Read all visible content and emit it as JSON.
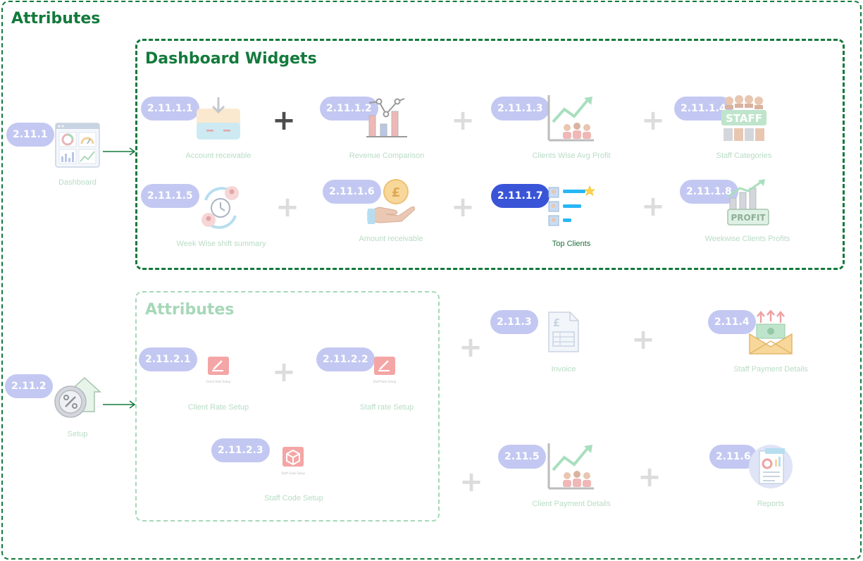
{
  "frames": {
    "outer_title": "Attributes",
    "dashboard_title": "Dashboard Widgets",
    "attributes_title": "Attributes"
  },
  "roots": [
    {
      "code": "2.11.1",
      "label": "Dashboard"
    },
    {
      "code": "2.11.2",
      "label": "Setup"
    }
  ],
  "widgets": [
    {
      "code": "2.11.1.1",
      "label": "Account receivable"
    },
    {
      "code": "2.11.1.2",
      "label": "Revenue Comparison"
    },
    {
      "code": "2.11.1.3",
      "label": "Clients Wise Avg Profit"
    },
    {
      "code": "2.11.1.4",
      "label": "Staff Categories",
      "icon_text": "STAFF"
    },
    {
      "code": "2.11.1.5",
      "label": "Week Wise shift summary"
    },
    {
      "code": "2.11.1.6",
      "label": "Amount receivable",
      "icon_text": "£"
    },
    {
      "code": "2.11.1.7",
      "label": "Top Clients",
      "active": true
    },
    {
      "code": "2.11.1.8",
      "label": "Weekwise Clients Profits",
      "icon_text": "PROFIT"
    }
  ],
  "setup_attributes": [
    {
      "code": "2.11.2.1",
      "label": "Client Rate Setup",
      "icon_caption": "Client Rate Setup"
    },
    {
      "code": "2.11.2.2",
      "label": "Staff rate Setup",
      "icon_caption": "Staff Rate Setup"
    },
    {
      "code": "2.11.2.3",
      "label": "Staff Code Setup",
      "icon_caption": "Staff Code Setup"
    }
  ],
  "setup_items": [
    {
      "code": "2.11.3",
      "label": "Invoice",
      "icon_text": "£"
    },
    {
      "code": "2.11.4",
      "label": "Staff Payment Details"
    },
    {
      "code": "2.11.5",
      "label": "Client Payment Details"
    },
    {
      "code": "2.11.6",
      "label": "Reports"
    }
  ],
  "plus_symbol": "+",
  "colors": {
    "frame_green": "#137a3c",
    "faded_green": "#a6d8b8",
    "badge": "#c3c8f2",
    "badge_active": "#3a54d8"
  }
}
